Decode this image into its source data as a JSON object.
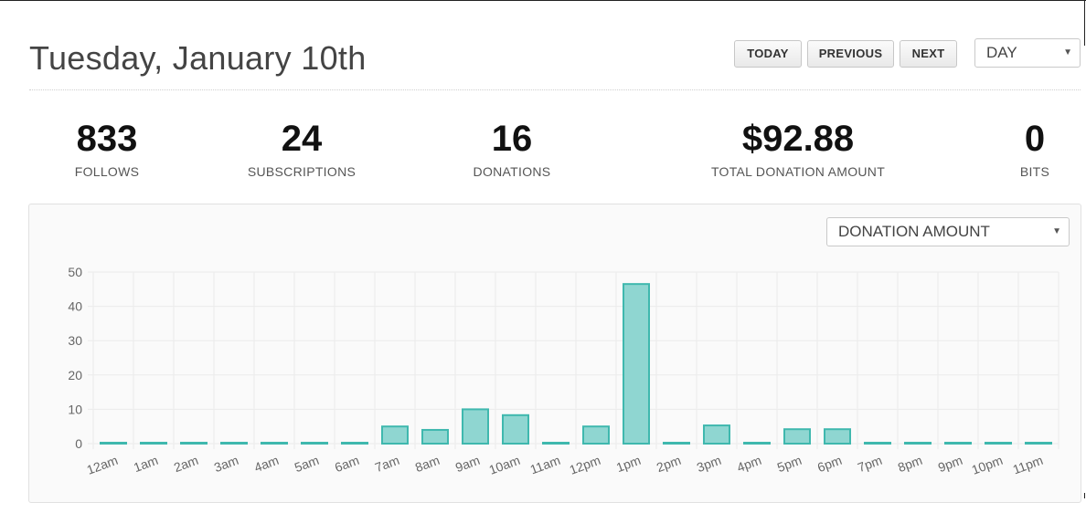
{
  "header": {
    "date_title": "Tuesday, January 10th",
    "today_label": "TODAY",
    "previous_label": "PREVIOUS",
    "next_label": "NEXT",
    "period_select": "DAY"
  },
  "stats": [
    {
      "value": "833",
      "label": "FOLLOWS"
    },
    {
      "value": "24",
      "label": "SUBSCRIPTIONS"
    },
    {
      "value": "16",
      "label": "DONATIONS"
    },
    {
      "value": "$92.88",
      "label": "TOTAL DONATION AMOUNT"
    },
    {
      "value": "0",
      "label": "BITS"
    }
  ],
  "chart_panel": {
    "metric_select": "DONATION AMOUNT"
  },
  "chart_data": {
    "type": "bar",
    "categories": [
      "12am",
      "1am",
      "2am",
      "3am",
      "4am",
      "5am",
      "6am",
      "7am",
      "8am",
      "9am",
      "10am",
      "11am",
      "12pm",
      "1pm",
      "2pm",
      "3pm",
      "4pm",
      "5pm",
      "6pm",
      "7pm",
      "8pm",
      "9pm",
      "10pm",
      "11pm"
    ],
    "values": [
      0,
      0,
      0,
      0,
      0,
      0,
      0,
      5,
      4,
      10,
      8.3,
      0,
      5,
      46.5,
      0,
      5.3,
      0,
      4.2,
      4.2,
      0,
      0,
      0,
      0,
      0
    ],
    "yticks": [
      0,
      10,
      20,
      30,
      40,
      50
    ],
    "ylim": [
      0,
      50
    ],
    "grid": true,
    "colors": {
      "bar_fill": "#8fd6d1",
      "bar_stroke": "#3fb8ae",
      "grid": "#ebebeb",
      "tick_text": "#666666"
    }
  }
}
